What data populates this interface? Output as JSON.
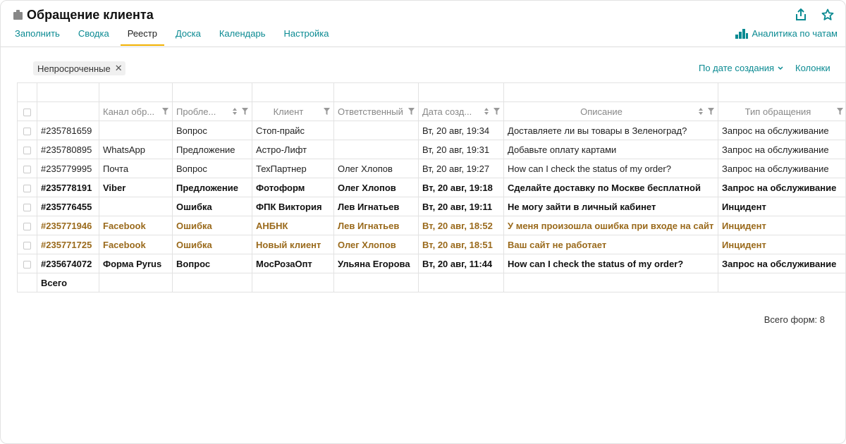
{
  "header": {
    "title": "Обращение клиента",
    "analytics_label": "Аналитика по чатам"
  },
  "tabs": [
    {
      "label": "Заполнить"
    },
    {
      "label": "Сводка"
    },
    {
      "label": "Реестр",
      "active": true
    },
    {
      "label": "Доска"
    },
    {
      "label": "Календарь"
    },
    {
      "label": "Настройка"
    }
  ],
  "toolbar": {
    "filter_chip": "Непросроченные",
    "chip_close": "✕",
    "sort_label": "По дате создания",
    "columns_label": "Колонки"
  },
  "table": {
    "columns": [
      "Канал обр...",
      "Пробле...",
      "Клиент",
      "Ответственный",
      "Дата созд...",
      "Описание",
      "Тип обращения"
    ],
    "rows": [
      {
        "id": "#235781659",
        "channel": "",
        "problem": "Вопрос",
        "client": "Стоп-прайс",
        "responsible": "",
        "date": "Вт, 20 авг, 19:34",
        "description": "Доставляете ли вы товары в Зеленоград?",
        "type": "Запрос на обслуживание",
        "style": "normal"
      },
      {
        "id": "#235780895",
        "channel": "WhatsApp",
        "problem": "Предложение",
        "client": "Астро-Лифт",
        "responsible": "",
        "date": "Вт, 20 авг, 19:31",
        "description": "Добавьте оплату картами",
        "type": "Запрос на обслуживание",
        "style": "normal"
      },
      {
        "id": "#235779995",
        "channel": "Почта",
        "problem": "Вопрос",
        "client": "ТехПартнер",
        "responsible": "Олег Хлопов",
        "date": "Вт, 20 авг, 19:27",
        "description": "How can I check the status of my order?",
        "type": "Запрос на обслуживание",
        "style": "normal"
      },
      {
        "id": "#235778191",
        "channel": "Viber",
        "problem": "Предложение",
        "client": "Фотоформ",
        "responsible": "Олег Хлопов",
        "date": "Вт, 20 авг, 19:18",
        "description": "Сделайте доставку по Москве бесплатной",
        "type": "Запрос на обслуживание",
        "style": "bold"
      },
      {
        "id": "#235776455",
        "channel": "",
        "problem": "Ошибка",
        "client": "ФПК Виктория",
        "responsible": "Лев Игнатьев",
        "date": "Вт, 20 авг, 19:11",
        "description": "Не могу зайти в личный кабинет",
        "type": "Инцидент",
        "style": "bold"
      },
      {
        "id": "#235771946",
        "channel": "Facebook",
        "problem": "Ошибка",
        "client": "АНБНК",
        "responsible": "Лев Игнатьев",
        "date": "Вт, 20 авг, 18:52",
        "description": "У меня произошла ошибка при входе на сайт",
        "type": "Инцидент",
        "style": "overdue"
      },
      {
        "id": "#235771725",
        "channel": "Facebook",
        "problem": "Ошибка",
        "client": "Новый клиент",
        "responsible": "Олег Хлопов",
        "date": "Вт, 20 авг, 18:51",
        "description": "Ваш сайт не работает",
        "type": "Инцидент",
        "style": "overdue"
      },
      {
        "id": "#235674072",
        "channel": "Форма Pyrus",
        "problem": "Вопрос",
        "client": "МосРозаОпт",
        "responsible": "Ульяна Егорова",
        "date": "Вт, 20 авг, 11:44",
        "description": "How can I check the status of my order?",
        "type": "Запрос на обслуживание",
        "style": "bold"
      }
    ],
    "total_label": "Всего"
  },
  "footer": {
    "count_text": "Всего форм: 8"
  },
  "colors": {
    "accent": "#0a8a92",
    "overdue": "#9a6a1c",
    "tab_underline": "#f0b000"
  },
  "icons": [
    "clipboard-icon",
    "share-icon",
    "star-icon",
    "bar-chart-icon",
    "filter-icon",
    "sort-icon",
    "close-icon",
    "chevron-down-icon"
  ]
}
